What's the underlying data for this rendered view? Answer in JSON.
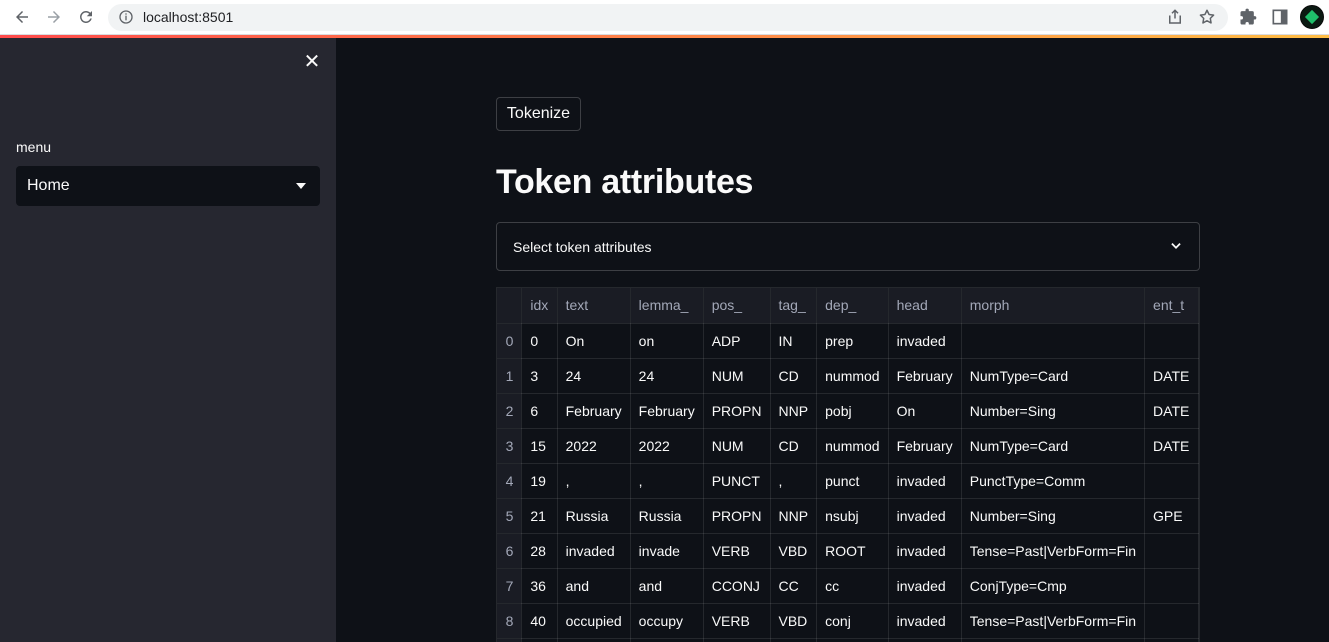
{
  "browser": {
    "url_host": "localhost:8501"
  },
  "sidebar": {
    "menu_label": "menu",
    "select_value": "Home"
  },
  "main": {
    "button_label": "Tokenize",
    "heading": "Token attributes",
    "multiselect_placeholder": "Select token attributes"
  },
  "table": {
    "columns": [
      "idx",
      "text",
      "lemma_",
      "pos_",
      "tag_",
      "dep_",
      "head",
      "morph",
      "ent_t"
    ],
    "rows": [
      {
        "index": "0",
        "cells": [
          "0",
          "On",
          "on",
          "ADP",
          "IN",
          "prep",
          "invaded",
          "",
          ""
        ]
      },
      {
        "index": "1",
        "cells": [
          "3",
          "24",
          "24",
          "NUM",
          "CD",
          "nummod",
          "February",
          "NumType=Card",
          "DATE"
        ]
      },
      {
        "index": "2",
        "cells": [
          "6",
          "February",
          "February",
          "PROPN",
          "NNP",
          "pobj",
          "On",
          "Number=Sing",
          "DATE"
        ]
      },
      {
        "index": "3",
        "cells": [
          "15",
          "2022",
          "2022",
          "NUM",
          "CD",
          "nummod",
          "February",
          "NumType=Card",
          "DATE"
        ]
      },
      {
        "index": "4",
        "cells": [
          "19",
          ",",
          ",",
          "PUNCT",
          ",",
          "punct",
          "invaded",
          "PunctType=Comm",
          ""
        ]
      },
      {
        "index": "5",
        "cells": [
          "21",
          "Russia",
          "Russia",
          "PROPN",
          "NNP",
          "nsubj",
          "invaded",
          "Number=Sing",
          "GPE"
        ]
      },
      {
        "index": "6",
        "cells": [
          "28",
          "invaded",
          "invade",
          "VERB",
          "VBD",
          "ROOT",
          "invaded",
          "Tense=Past|VerbForm=Fin",
          ""
        ]
      },
      {
        "index": "7",
        "cells": [
          "36",
          "and",
          "and",
          "CCONJ",
          "CC",
          "cc",
          "invaded",
          "ConjType=Cmp",
          ""
        ]
      },
      {
        "index": "8",
        "cells": [
          "40",
          "occupied",
          "occupy",
          "VERB",
          "VBD",
          "conj",
          "invaded",
          "Tense=Past|VerbForm=Fin",
          ""
        ]
      },
      {
        "index": "",
        "cells": [
          "",
          "",
          "",
          "",
          "",
          "",
          "",
          "",
          ""
        ]
      }
    ]
  },
  "colors": {
    "app_bg": "#0e1117",
    "sidebar_bg": "#262730",
    "accent_start": "#ff4b4b",
    "accent_end": "#ffbd45"
  },
  "icons": {
    "back": "arrow-left-icon",
    "forward": "arrow-right-icon",
    "reload": "reload-icon",
    "info": "info-icon",
    "share": "share-icon",
    "bookmark": "star-icon",
    "extensions": "puzzle-icon",
    "sidepanel": "side-panel-icon",
    "close": "close-icon",
    "caret": "caret-down-icon",
    "chevron": "chevron-down-icon"
  }
}
